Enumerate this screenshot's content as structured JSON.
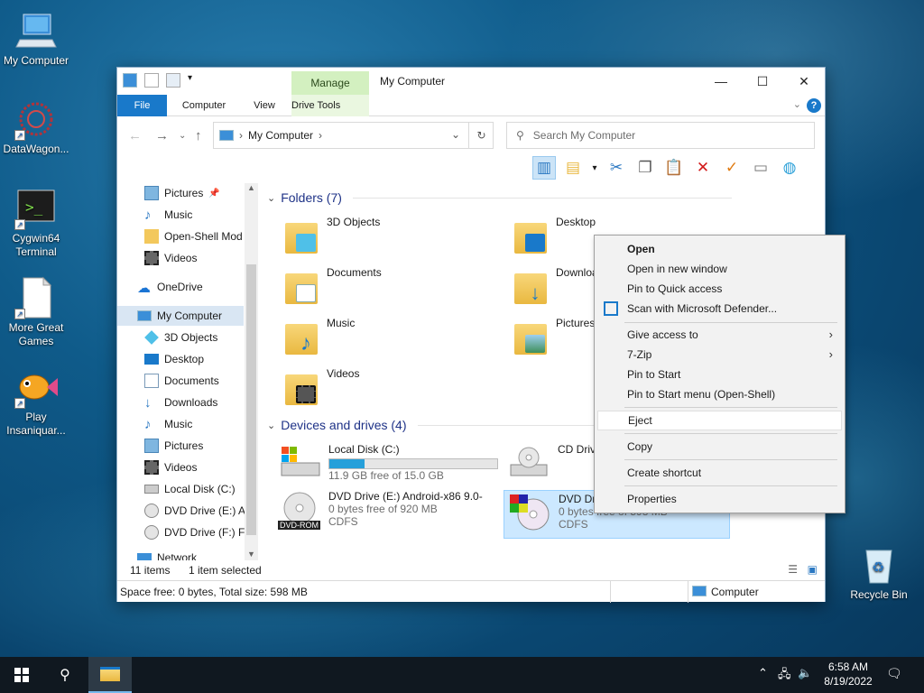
{
  "desktop": {
    "icons": [
      {
        "label": "My Computer"
      },
      {
        "label": "DataWagon..."
      },
      {
        "label": "Cygwin64 Terminal"
      },
      {
        "label": "More Great Games"
      },
      {
        "label": "Play Insaniquar..."
      },
      {
        "label": "Recycle Bin"
      }
    ]
  },
  "window": {
    "title": "My Computer",
    "contextual_tab": "Manage",
    "tabs": [
      "File",
      "Computer",
      "View",
      "Drive Tools"
    ],
    "address": {
      "crumb": "My Computer"
    },
    "search": {
      "placeholder": "Search My Computer"
    }
  },
  "nav": {
    "items": [
      {
        "label": "Pictures",
        "pinned": true
      },
      {
        "label": "Music"
      },
      {
        "label": "Open-Shell Mod"
      },
      {
        "label": "Videos"
      },
      {
        "label": "OneDrive"
      },
      {
        "label": "My Computer",
        "selected": true
      },
      {
        "label": "3D Objects"
      },
      {
        "label": "Desktop"
      },
      {
        "label": "Documents"
      },
      {
        "label": "Downloads"
      },
      {
        "label": "Music"
      },
      {
        "label": "Pictures"
      },
      {
        "label": "Videos"
      },
      {
        "label": "Local Disk (C:)"
      },
      {
        "label": "DVD Drive (E:) Ar"
      },
      {
        "label": "DVD Drive (F:) Fr"
      },
      {
        "label": "Network"
      }
    ]
  },
  "content": {
    "folders_header": "Folders (7)",
    "folders": [
      "3D Objects",
      "Desktop",
      "Documents",
      "Downloads",
      "Music",
      "Pictures",
      "Videos"
    ],
    "drives_header": "Devices and drives (4)",
    "drives": [
      {
        "name": "Local Disk (C:)",
        "free": "11.9 GB free of 15.0 GB",
        "used_fraction": 0.21
      },
      {
        "name": "CD Drive",
        "free": ""
      },
      {
        "name": "DVD Drive (E:) Android-x86 9.0-",
        "free": "0 bytes free of 920 MB",
        "fs": "CDFS",
        "badge": "DVD-ROM"
      },
      {
        "name": "DVD Driv",
        "free": "0 bytes free of 598 MB",
        "fs": "CDFS"
      }
    ]
  },
  "status": {
    "item_count": "11 items",
    "selected": "1 item selected",
    "space": "Space free: 0 bytes, Total size: 598 MB",
    "location": "Computer"
  },
  "context_menu": {
    "items": [
      "Open",
      "Open in new window",
      "Pin to Quick access",
      "Scan with Microsoft Defender...",
      "Give access to",
      "7-Zip",
      "Pin to Start",
      "Pin to Start menu (Open-Shell)",
      "Eject",
      "Copy",
      "Create shortcut",
      "Properties"
    ]
  },
  "taskbar": {
    "time": "6:58 AM",
    "date": "8/19/2022"
  },
  "colors": {
    "accent": "#1979ca",
    "manage_tab": "#d3f0c0",
    "selection": "#cce8ff"
  }
}
